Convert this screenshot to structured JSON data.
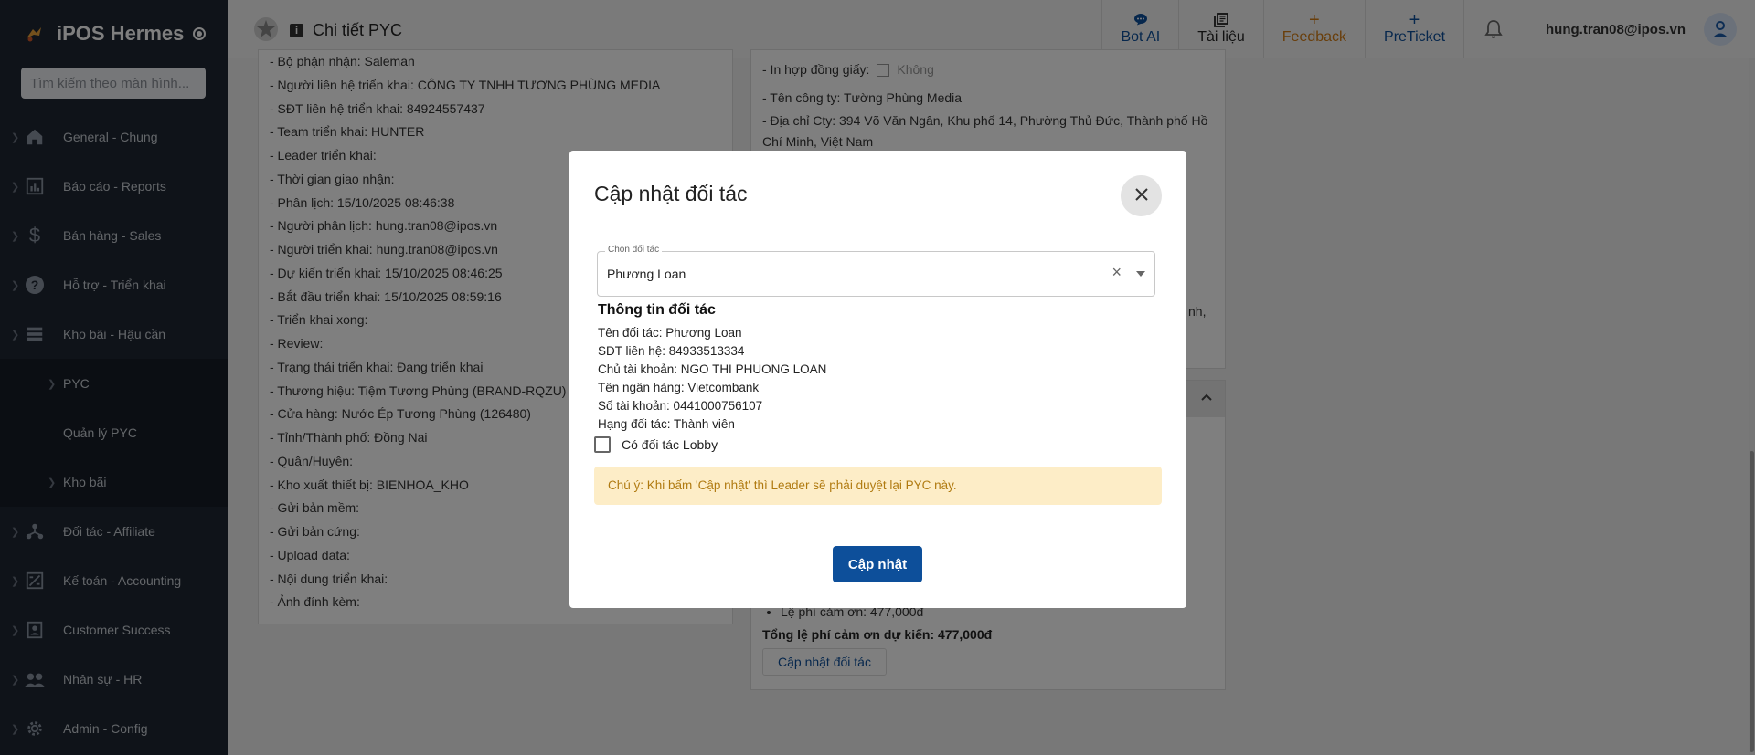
{
  "app": {
    "title": "iPOS Hermes"
  },
  "sidebar": {
    "search_placeholder": "Tìm kiếm theo màn hình...",
    "items": [
      {
        "label": "General - Chung",
        "icon": "home-icon"
      },
      {
        "label": "Báo cáo - Reports",
        "icon": "bar-chart-icon"
      },
      {
        "label": "Bán hàng - Sales",
        "icon": "dollar-icon"
      },
      {
        "label": "Hỗ trợ - Triển khai",
        "icon": "help-icon"
      },
      {
        "label": "Kho bãi - Hậu cần",
        "icon": "list-icon"
      }
    ],
    "subitems": [
      {
        "label": "PYC"
      },
      {
        "label": "Quản lý PYC"
      },
      {
        "label": "Kho bãi"
      }
    ],
    "items2": [
      {
        "label": "Đối tác - Affiliate",
        "icon": "network-icon"
      },
      {
        "label": "Kế toán - Accounting",
        "icon": "calculator-icon"
      },
      {
        "label": "Customer Success",
        "icon": "contact-card-icon"
      },
      {
        "label": "Nhân sự - HR",
        "icon": "people-icon"
      },
      {
        "label": "Admin - Config",
        "icon": "gear-icon"
      }
    ]
  },
  "topbar": {
    "page_title": "Chi tiết PYC",
    "buttons": [
      {
        "label": "Bot AI",
        "color": "#0d4f9a"
      },
      {
        "label": "Tài liệu",
        "color": "#222222"
      },
      {
        "label": "Feedback",
        "color": "#d27c15"
      },
      {
        "label": "PreTicket",
        "color": "#0d4f9a"
      }
    ],
    "user_email": "hung.tran08@ipos.vn"
  },
  "left_panel": {
    "lines": [
      "- Bộ phận nhận: Saleman",
      "- Người liên hệ triển khai: CÔNG TY TNHH TƯƠNG PHÙNG MEDIA",
      "- SĐT liên hệ triển khai: 84924557437",
      "- Team triển khai: HUNTER",
      "- Leader triển khai:",
      "- Thời gian giao nhận:",
      "- Phân lịch: 15/10/2025 08:46:38",
      "- Người phân lịch: hung.tran08@ipos.vn",
      "- Người triển khai: hung.tran08@ipos.vn",
      "- Dự kiến triển khai: 15/10/2025 08:46:25",
      "- Bắt đầu triển khai: 15/10/2025 08:59:16",
      "- Triển khai xong:",
      "- Review:",
      "- Trạng thái triển khai: Đang triển khai",
      "- Thương hiệu: Tiệm Tương Phùng (BRAND-RQZU)",
      "- Cửa hàng: Nước Ép Tương Phùng (126480)",
      "- Tỉnh/Thành phố: Đồng Nai",
      "- Quận/Huyện:",
      "- Kho xuất thiết bị: BIENHOA_KHO",
      "- Gửi bản mềm:",
      "- Gửi bản cứng:",
      "- Upload data:",
      "- Nội dung triển khai:",
      "- Ảnh đính kèm:"
    ]
  },
  "right_panel": {
    "contract_label": "- In hợp đồng giấy:",
    "contract_value": "Không",
    "company": "- Tên công ty: Tường Phùng Media",
    "address": "- Địa chỉ Cty: 394 Võ Văn Ngân, Khu phố 14, Phường Thủ Đức, Thành phố Hồ Chí Minh, Việt Nam",
    "partial": "nh,",
    "fee_item": "Lệ phí cảm ơn: 477,000đ",
    "fee_total": "Tổng lệ phí cảm ơn dự kiến: 477,000đ",
    "update_partner_link": "Cập nhật đối tác"
  },
  "modal": {
    "title": "Cập nhật đối tác",
    "select_label": "Chọn đối tác",
    "select_value": "Phương Loan",
    "info_heading": "Thông tin đối tác",
    "info_lines": [
      "Tên đối tác: Phương Loan",
      "SDT liên hệ: 84933513334",
      "Chủ tài khoản: NGO THI PHUONG LOAN",
      "Tên ngân hàng: Vietcombank",
      "Số tài khoản: 0441000756107",
      "Hạng đối tác: Thành viên"
    ],
    "lobby_label": "Có đối tác Lobby",
    "alert": "Chú ý: Khi bấm 'Cập nhật' thì Leader sẽ phải duyệt lại PYC này.",
    "submit_label": "Cập nhật"
  }
}
